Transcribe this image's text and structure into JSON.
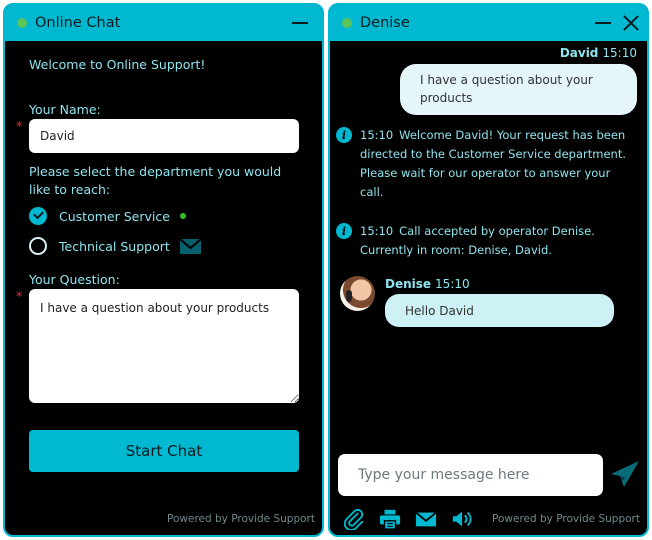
{
  "colors": {
    "accent": "#00b9d1",
    "status_online": "#59c55a",
    "required": "#e0302d",
    "text_cyan": "#8fe3ee"
  },
  "left": {
    "title": "Online Chat",
    "welcome": "Welcome to Online Support!",
    "name_label": "Your Name:",
    "name_value": "David",
    "required_mark": "*",
    "department_label": "Please select the department you would like to reach:",
    "departments": [
      {
        "label": "Customer Service",
        "selected": true,
        "status": "online"
      },
      {
        "label": "Technical Support",
        "selected": false,
        "status": "offline-email"
      }
    ],
    "question_label": "Your Question:",
    "question_value": "I have a question about your products",
    "start_button": "Start Chat",
    "powered_by": "Powered by Provide Support"
  },
  "right": {
    "title": "Denise",
    "messages": [
      {
        "type": "visitor",
        "author": "David",
        "time": "15:10",
        "text": "I have a question about your products"
      },
      {
        "type": "system",
        "time": "15:10",
        "text": "Welcome David! Your request has been directed to the Customer Service department. Please wait for our operator to answer your call."
      },
      {
        "type": "system",
        "time": "15:10",
        "text": "Call accepted by operator Denise. Currently in room: Denise, David."
      },
      {
        "type": "operator",
        "author": "Denise",
        "time": "15:10",
        "text": "Hello David"
      }
    ],
    "input_placeholder": "Type your message here",
    "toolbar_icons": [
      "paperclip-icon",
      "printer-icon",
      "email-icon",
      "sound-icon"
    ],
    "powered_by": "Powered by Provide Support"
  }
}
